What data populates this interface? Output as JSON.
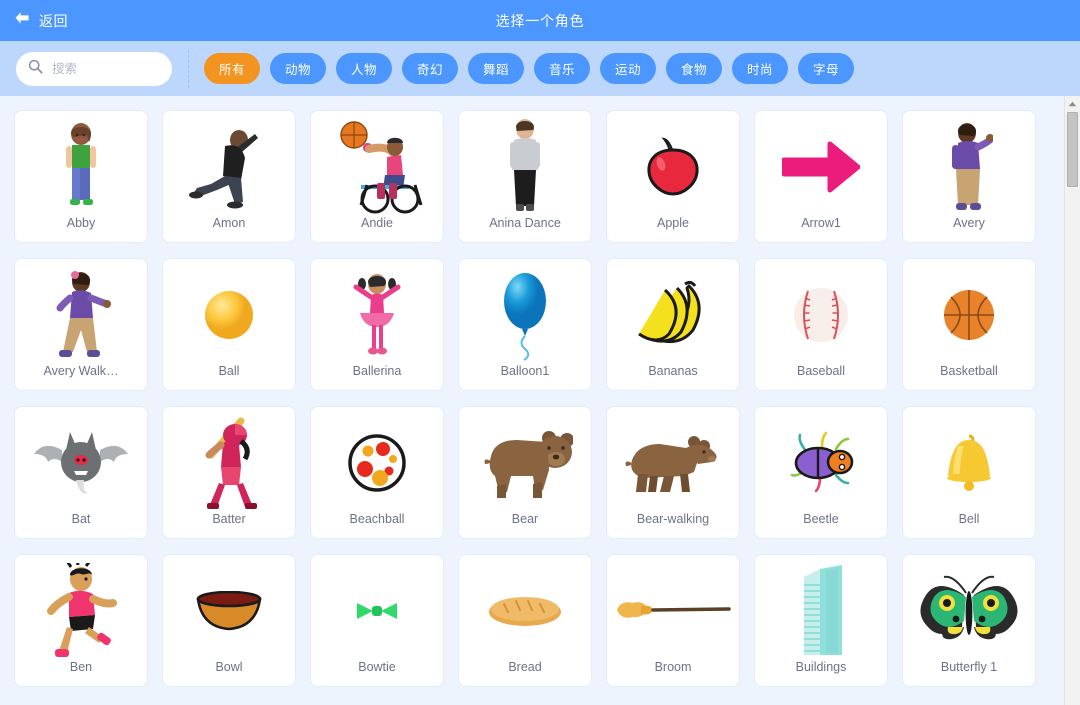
{
  "header": {
    "back_label": "返回",
    "back_icon": "arrow-left-icon",
    "title": "选择一个角色",
    "bg_color": "#4c97ff"
  },
  "search": {
    "icon": "search-icon",
    "placeholder": "搜索",
    "value": ""
  },
  "filters": {
    "active_index": 0,
    "active_color": "#f2941f",
    "inactive_color": "#4c97ff",
    "tags": [
      {
        "label": "所有"
      },
      {
        "label": "动物"
      },
      {
        "label": "人物"
      },
      {
        "label": "奇幻"
      },
      {
        "label": "舞蹈"
      },
      {
        "label": "音乐"
      },
      {
        "label": "运动"
      },
      {
        "label": "食物"
      },
      {
        "label": "时尚"
      },
      {
        "label": "字母"
      }
    ]
  },
  "library": {
    "background": "#eef4fd",
    "columns": 7,
    "sprites": [
      {
        "name": "Abby",
        "icon": "person-abby-icon"
      },
      {
        "name": "Amon",
        "icon": "person-amon-icon"
      },
      {
        "name": "Andie",
        "icon": "person-andie-wheelchair-icon"
      },
      {
        "name": "Anina Dance",
        "icon": "person-anina-dance-icon"
      },
      {
        "name": "Apple",
        "icon": "apple-icon"
      },
      {
        "name": "Arrow1",
        "icon": "arrow-right-icon"
      },
      {
        "name": "Avery",
        "icon": "person-avery-icon"
      },
      {
        "name": "Avery Walk…",
        "icon": "person-avery-walking-icon"
      },
      {
        "name": "Ball",
        "icon": "ball-icon"
      },
      {
        "name": "Ballerina",
        "icon": "person-ballerina-icon"
      },
      {
        "name": "Balloon1",
        "icon": "balloon-icon"
      },
      {
        "name": "Bananas",
        "icon": "bananas-icon"
      },
      {
        "name": "Baseball",
        "icon": "baseball-icon"
      },
      {
        "name": "Basketball",
        "icon": "basketball-icon"
      },
      {
        "name": "Bat",
        "icon": "bat-icon"
      },
      {
        "name": "Batter",
        "icon": "person-batter-icon"
      },
      {
        "name": "Beachball",
        "icon": "beachball-icon"
      },
      {
        "name": "Bear",
        "icon": "bear-icon"
      },
      {
        "name": "Bear-walking",
        "icon": "bear-walking-icon"
      },
      {
        "name": "Beetle",
        "icon": "beetle-icon"
      },
      {
        "name": "Bell",
        "icon": "bell-icon"
      },
      {
        "name": "Ben",
        "icon": "person-ben-icon"
      },
      {
        "name": "Bowl",
        "icon": "bowl-icon"
      },
      {
        "name": "Bowtie",
        "icon": "bowtie-icon"
      },
      {
        "name": "Bread",
        "icon": "bread-icon"
      },
      {
        "name": "Broom",
        "icon": "broom-icon"
      },
      {
        "name": "Buildings",
        "icon": "buildings-icon"
      },
      {
        "name": "Butterfly 1",
        "icon": "butterfly-icon"
      }
    ]
  },
  "scrollbar": {
    "up_arrow_icon": "chevron-up-icon",
    "thumb_position_percent": 3
  }
}
